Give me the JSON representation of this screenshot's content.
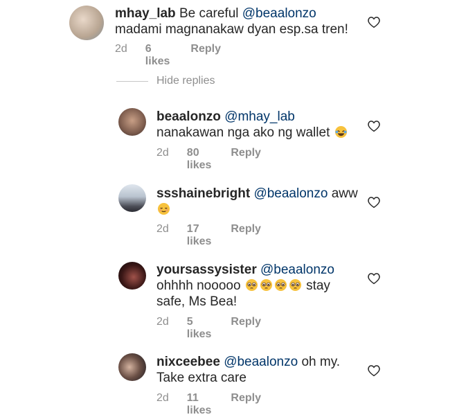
{
  "comments": [
    {
      "username": "mhay_lab",
      "mention": "@beaalonzo",
      "prefix": "Be careful ",
      "text": "madami magnanakaw dyan esp.sa tren!",
      "time": "2d",
      "likes": "6 likes",
      "reply": "Reply"
    },
    {
      "username": "beaalonzo",
      "mention": "@mhay_lab",
      "prefix": "",
      "text": "nanakawan nga ako ng wallet",
      "time": "2d",
      "likes": "80 likes",
      "reply": "Reply"
    },
    {
      "username": "ssshainebright",
      "mention": "@beaalonzo",
      "prefix": "",
      "text": "aww",
      "time": "2d",
      "likes": "17 likes",
      "reply": "Reply"
    },
    {
      "username": "yoursassysister",
      "mention": "@beaalonzo",
      "prefix": "",
      "text": "ohhhh nooooo",
      "text2": "stay",
      "text3": "safe, Ms Bea!",
      "time": "2d",
      "likes": "5 likes",
      "reply": "Reply"
    },
    {
      "username": "nixceebee",
      "mention": "@beaalonzo",
      "prefix": "",
      "text": "oh my.",
      "text2": "Take extra care",
      "time": "2d",
      "likes": "11 likes",
      "reply": "Reply"
    }
  ],
  "hide_replies": "Hide replies",
  "colors": {
    "text": "#262626",
    "meta": "#8e8e8e",
    "mention": "#003569"
  }
}
